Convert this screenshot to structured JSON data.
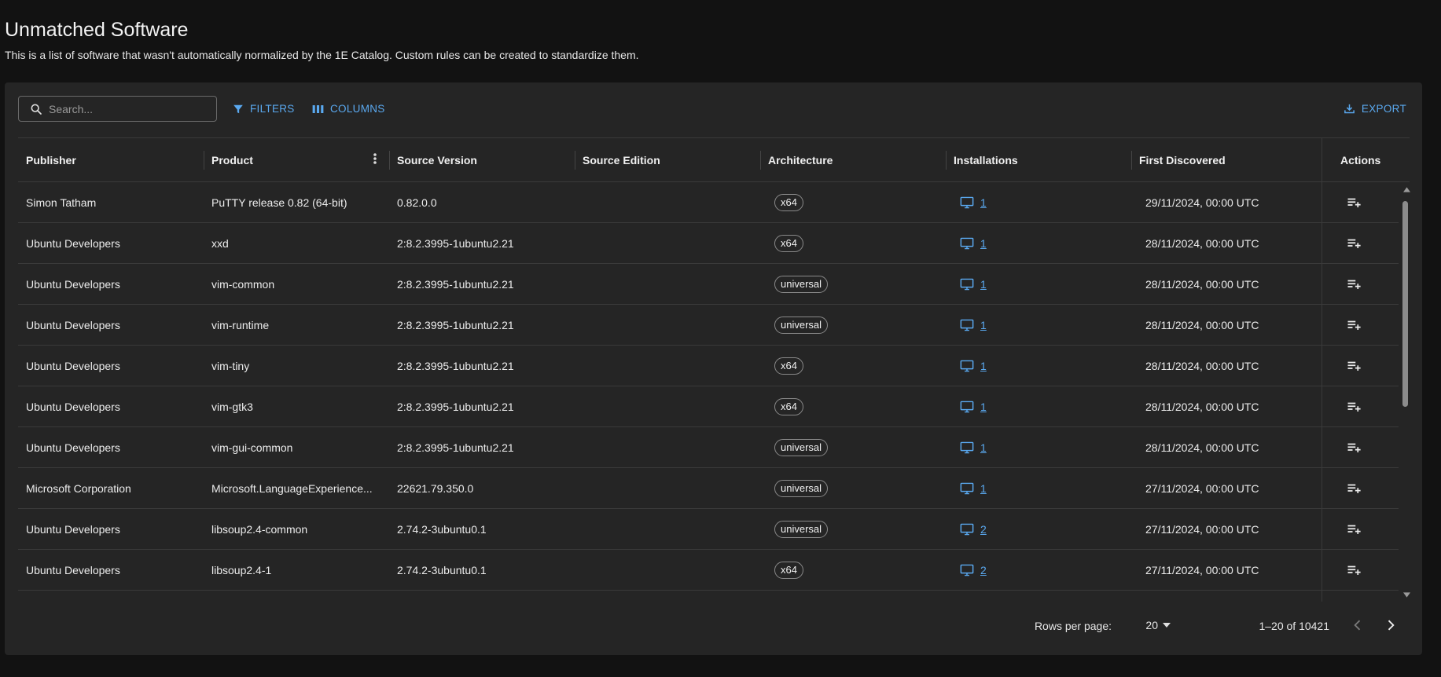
{
  "header": {
    "title": "Unmatched Software",
    "subtitle": "This is a list of software that wasn't automatically normalized by the 1E Catalog. Custom rules can be created to standardize them."
  },
  "toolbar": {
    "search_placeholder": "Search...",
    "filters_label": "FILTERS",
    "columns_label": "COLUMNS",
    "export_label": "EXPORT"
  },
  "colors": {
    "accent": "#5aa9f0",
    "background": "#121212",
    "card": "#252525"
  },
  "table": {
    "columns": [
      "Publisher",
      "Product",
      "Source Version",
      "Source Edition",
      "Architecture",
      "Installations",
      "First Discovered",
      "Actions"
    ],
    "rows": [
      {
        "publisher": "Simon Tatham",
        "product": "PuTTY release 0.82 (64-bit)",
        "version": "0.82.0.0",
        "edition": "",
        "arch": "x64",
        "installations": "1",
        "first_discovered": "29/11/2024, 00:00 UTC"
      },
      {
        "publisher": "Ubuntu Developers",
        "product": "xxd",
        "version": "2:8.2.3995-1ubuntu2.21",
        "edition": "",
        "arch": "x64",
        "installations": "1",
        "first_discovered": "28/11/2024, 00:00 UTC"
      },
      {
        "publisher": "Ubuntu Developers",
        "product": "vim-common",
        "version": "2:8.2.3995-1ubuntu2.21",
        "edition": "",
        "arch": "universal",
        "installations": "1",
        "first_discovered": "28/11/2024, 00:00 UTC"
      },
      {
        "publisher": "Ubuntu Developers",
        "product": "vim-runtime",
        "version": "2:8.2.3995-1ubuntu2.21",
        "edition": "",
        "arch": "universal",
        "installations": "1",
        "first_discovered": "28/11/2024, 00:00 UTC"
      },
      {
        "publisher": "Ubuntu Developers",
        "product": "vim-tiny",
        "version": "2:8.2.3995-1ubuntu2.21",
        "edition": "",
        "arch": "x64",
        "installations": "1",
        "first_discovered": "28/11/2024, 00:00 UTC"
      },
      {
        "publisher": "Ubuntu Developers",
        "product": "vim-gtk3",
        "version": "2:8.2.3995-1ubuntu2.21",
        "edition": "",
        "arch": "x64",
        "installations": "1",
        "first_discovered": "28/11/2024, 00:00 UTC"
      },
      {
        "publisher": "Ubuntu Developers",
        "product": "vim-gui-common",
        "version": "2:8.2.3995-1ubuntu2.21",
        "edition": "",
        "arch": "universal",
        "installations": "1",
        "first_discovered": "28/11/2024, 00:00 UTC"
      },
      {
        "publisher": "Microsoft Corporation",
        "product": "Microsoft.LanguageExperience...",
        "version": "22621.79.350.0",
        "edition": "",
        "arch": "universal",
        "installations": "1",
        "first_discovered": "27/11/2024, 00:00 UTC"
      },
      {
        "publisher": "Ubuntu Developers",
        "product": "libsoup2.4-common",
        "version": "2.74.2-3ubuntu0.1",
        "edition": "",
        "arch": "universal",
        "installations": "2",
        "first_discovered": "27/11/2024, 00:00 UTC"
      },
      {
        "publisher": "Ubuntu Developers",
        "product": "libsoup2.4-1",
        "version": "2.74.2-3ubuntu0.1",
        "edition": "",
        "arch": "x64",
        "installations": "2",
        "first_discovered": "27/11/2024, 00:00 UTC"
      }
    ]
  },
  "pagination": {
    "rows_per_page_label": "Rows per page:",
    "rows_per_page_value": "20",
    "range_text": "1–20 of 10421"
  }
}
